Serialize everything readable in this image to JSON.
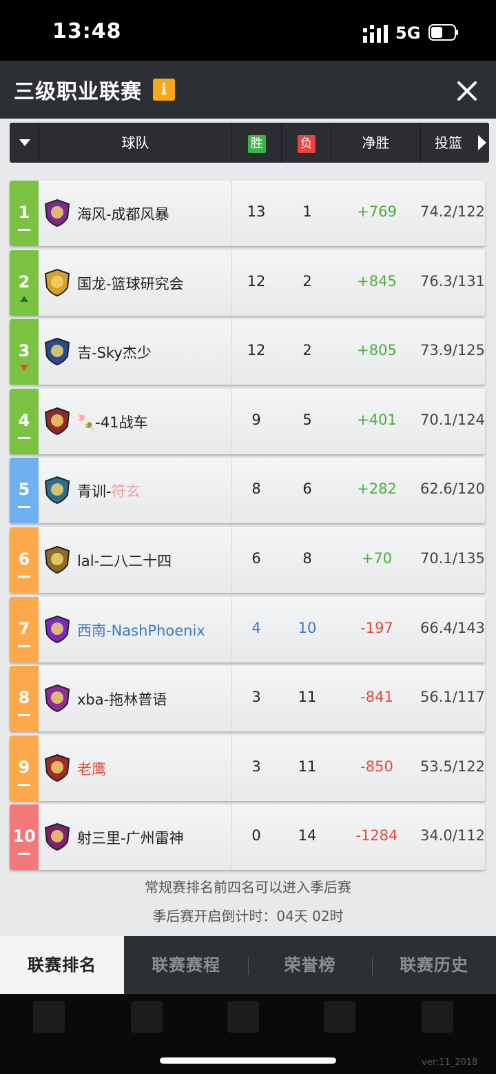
{
  "status_bar": {
    "time": "13:48",
    "network": "5G"
  },
  "header": {
    "title": "三级职业联赛",
    "info_badge": "i"
  },
  "columns": {
    "team": "球队",
    "wins": "胜",
    "losses": "负",
    "net": "净胜",
    "shooting": "投篮"
  },
  "colors": {
    "green_rank": "#7bc242",
    "blue_rank": "#6fb0ee",
    "orange_rank": "#fba94b",
    "red_rank": "#f2787a",
    "positive": "#4caf3a",
    "negative": "#e24b3b",
    "highlight_blue": "#3a78c9",
    "highlight_red": "#e24b3b"
  },
  "teams": [
    {
      "rank": "1",
      "trend": "same",
      "name": "海风-成都风暴",
      "wins": "13",
      "losses": "1",
      "net": "+769",
      "shooting": "74.2/122",
      "rank_color": "green",
      "logo": "dragon-logo"
    },
    {
      "rank": "2",
      "trend": "up",
      "name": "国龙-篮球研究会",
      "wins": "12",
      "losses": "2",
      "net": "+845",
      "shooting": "76.3/131",
      "rank_color": "green",
      "logo": "spartan-logo"
    },
    {
      "rank": "3",
      "trend": "down",
      "name": "吉-Sky杰少",
      "wins": "12",
      "losses": "2",
      "net": "+805",
      "shooting": "73.9/125",
      "rank_color": "green",
      "logo": "wolf-logo"
    },
    {
      "rank": "4",
      "trend": "same",
      "name": "🍡-41战车",
      "wins": "9",
      "losses": "5",
      "net": "+401",
      "shooting": "70.1/124",
      "rank_color": "green",
      "logo": "warrior-logo"
    },
    {
      "rank": "5",
      "trend": "same",
      "name_prefix": "青训-",
      "name_suffix": "符玄",
      "wins": "8",
      "losses": "6",
      "net": "+282",
      "shooting": "62.6/120",
      "rank_color": "blue",
      "logo": "wolf-gold-logo"
    },
    {
      "rank": "6",
      "trend": "same",
      "name": "lal-二八二十四",
      "wins": "6",
      "losses": "8",
      "net": "+70",
      "shooting": "70.1/135",
      "rank_color": "orange",
      "logo": "tiger-logo"
    },
    {
      "rank": "7",
      "trend": "same",
      "name": "西南-NashPhoenix",
      "wins": "4",
      "losses": "10",
      "net": "-197",
      "shooting": "66.4/143",
      "rank_color": "orange",
      "logo": "lion-logo"
    },
    {
      "rank": "8",
      "trend": "same",
      "name": "xba-拖林普语",
      "wins": "3",
      "losses": "11",
      "net": "-841",
      "shooting": "56.1/117",
      "rank_color": "orange",
      "logo": "beast-logo"
    },
    {
      "rank": "9",
      "trend": "same",
      "name": "老鹰",
      "wins": "3",
      "losses": "11",
      "net": "-850",
      "shooting": "53.5/122",
      "rank_color": "orange",
      "logo": "eagle-logo"
    },
    {
      "rank": "10",
      "trend": "same",
      "name": "射三里-广州雷神",
      "wins": "0",
      "losses": "14",
      "net": "-1284",
      "shooting": "34.0/112",
      "rank_color": "red",
      "logo": "demon-logo"
    }
  ],
  "notes": {
    "line1": "常规赛排名前四名可以进入季后赛",
    "line2": "季后赛开启倒计时：04天 02时"
  },
  "tabs": [
    "联赛排名",
    "联赛赛程",
    "荣誉榜",
    "联赛历史"
  ],
  "version": "ver:11_2018"
}
